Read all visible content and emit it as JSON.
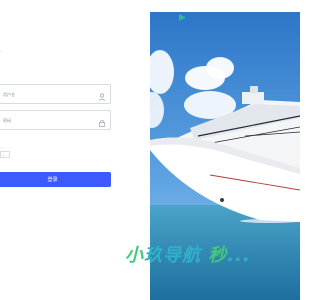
{
  "login": {
    "subtitle": "...",
    "username_placeholder": "用户名",
    "password_placeholder": "密码",
    "remember_label": "...",
    "remember_value": "...",
    "login_label": "登录"
  },
  "brand": {
    "text_part1": "小",
    "text_part2": "玖导航",
    "text_part3": "秒",
    "text_part4": "...",
    "colors": {
      "green": "#42c97a",
      "teal": "#2fb2c8",
      "button": "#3d5afe"
    }
  },
  "icons": {
    "username": "user-icon",
    "password": "lock-icon",
    "logo": "logo-icon"
  }
}
